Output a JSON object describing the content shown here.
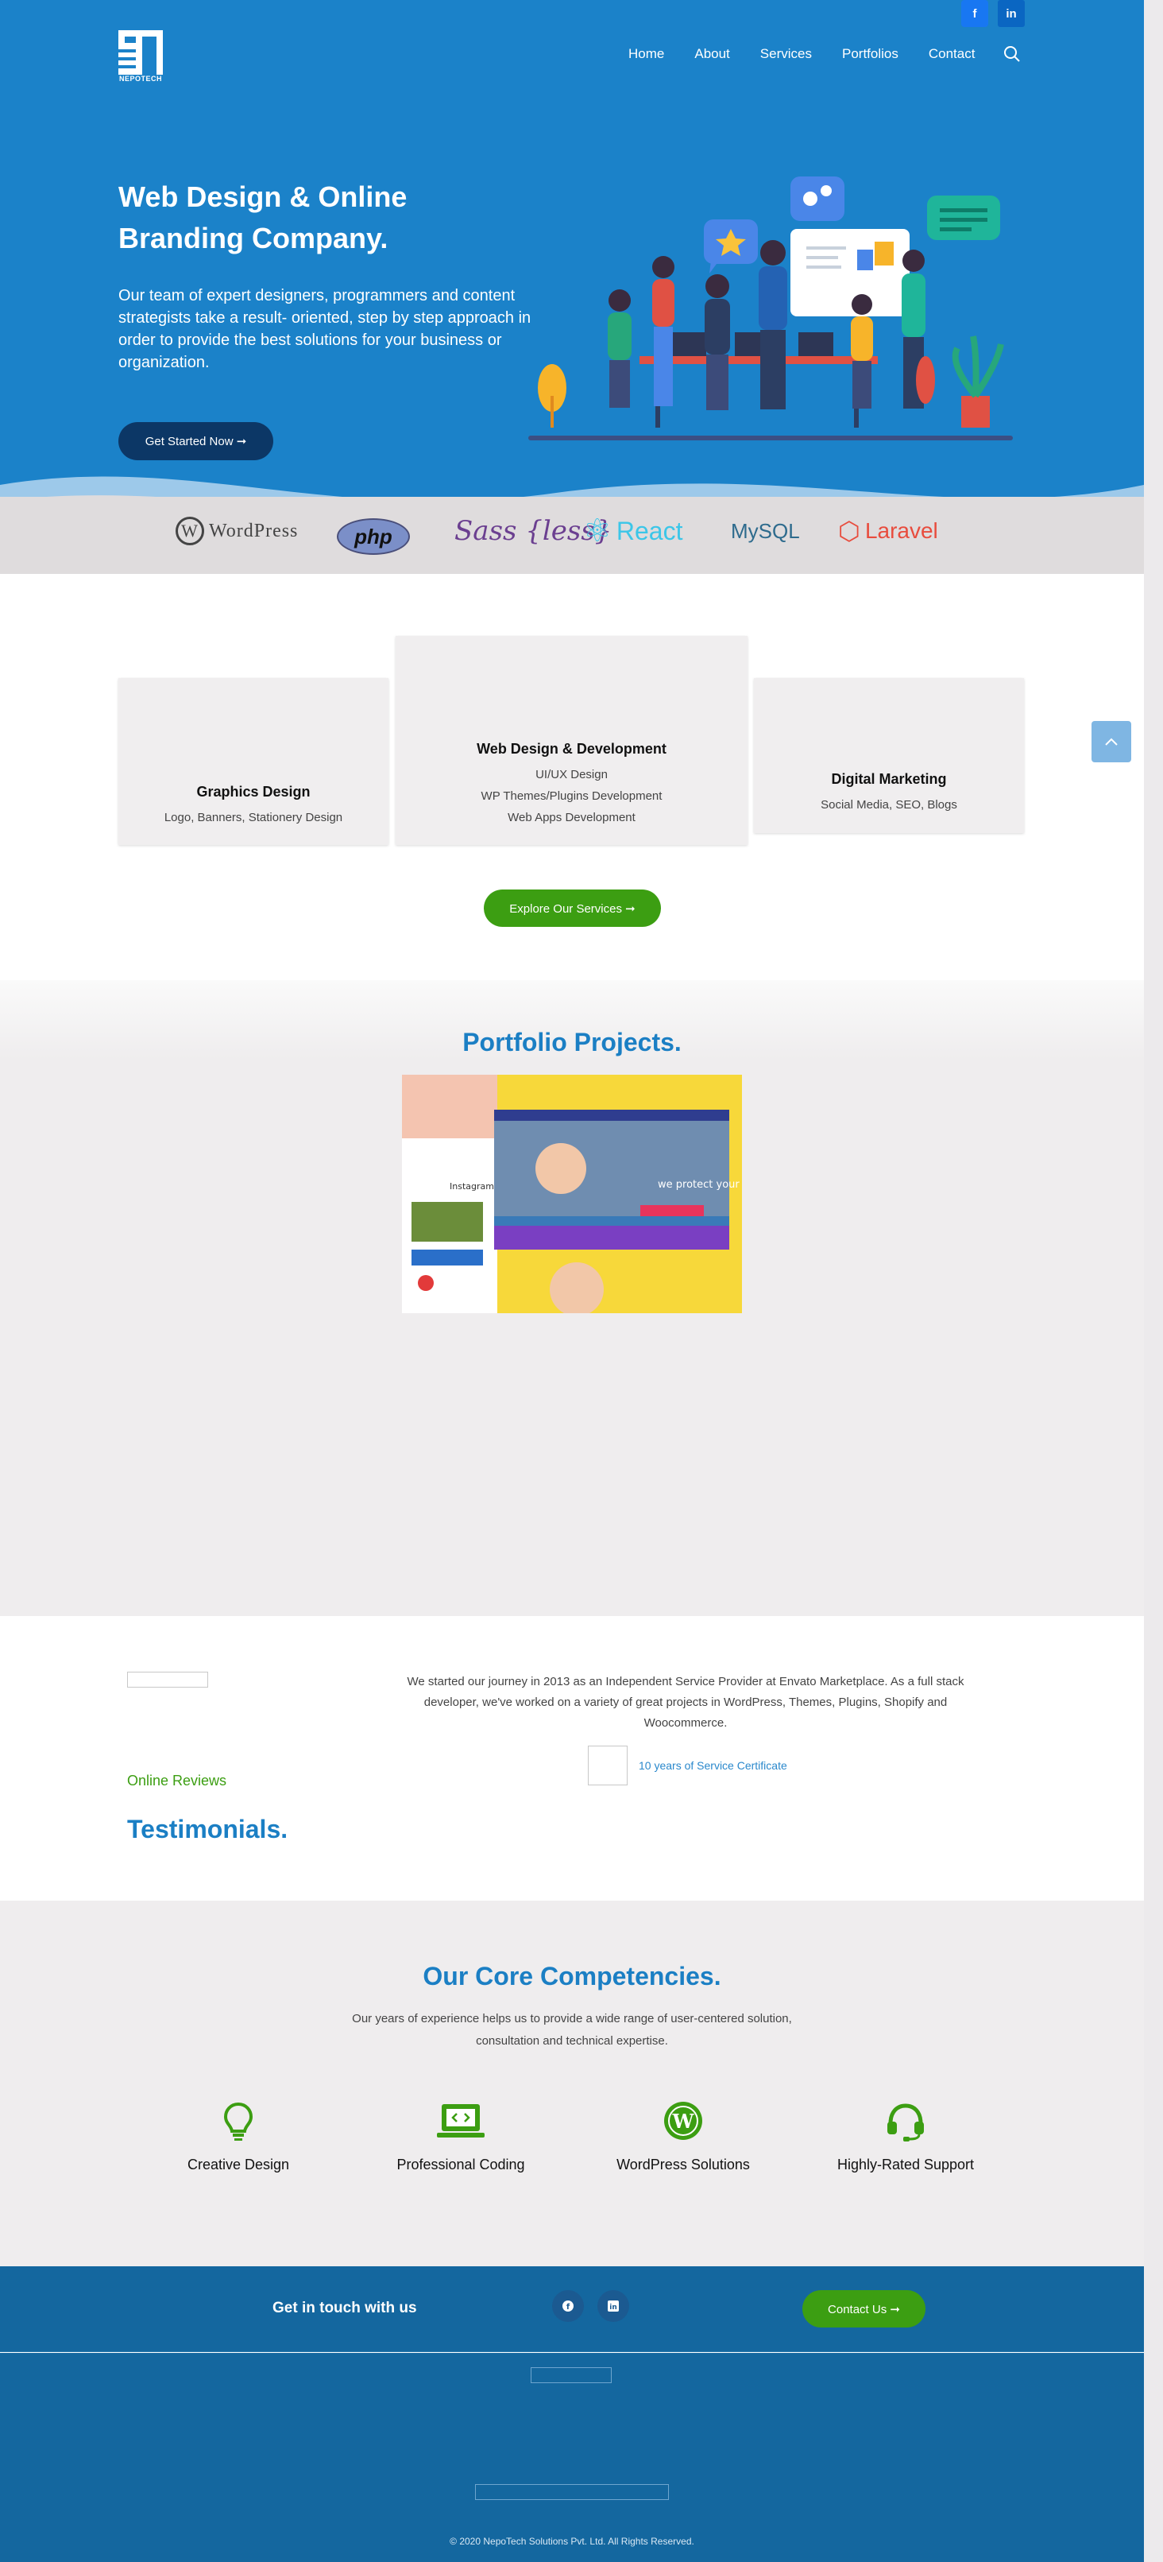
{
  "brand": {
    "logo_text": "NEPOTECH"
  },
  "nav": {
    "items": [
      "Home",
      "About",
      "Services",
      "Portfolios",
      "Contact"
    ]
  },
  "social": {
    "facebook": "f",
    "linkedin": "in"
  },
  "hero": {
    "title": "Web Design & Online Branding Company.",
    "lead": "Our team of expert designers, programmers and content strategists take a result- oriented, step by step approach in order to provide the best solutions for your business or organization.",
    "cta": "Get Started Now ➞"
  },
  "tech_logos": {
    "wordpress": "WordPress",
    "php": "php",
    "sass_less": "Sass {less}",
    "react": "React",
    "mysql": "MySQL",
    "laravel": "Laravel"
  },
  "services": {
    "cards": [
      {
        "title": "Graphics Design",
        "lines": [
          "Logo, Banners, Stationery Design"
        ]
      },
      {
        "title": "Web Design & Development",
        "lines": [
          "UI/UX Design",
          "WP Themes/Plugins Development",
          "Web Apps Development"
        ]
      },
      {
        "title": "Digital Marketing",
        "lines": [
          "Social Media, SEO, Blogs"
        ]
      }
    ],
    "cta": "Explore Our Services ➞"
  },
  "portfolio": {
    "heading": "Portfolio Projects.",
    "shot_caption": "we protect your baby",
    "shot_tag": "Instagram"
  },
  "testimonials": {
    "about": "We started our journey in 2013 as an Independent Service Provider at Envato Marketplace. As a full stack developer, we've worked on a variety of great projects in WordPress, Themes, Plugins, Shopify and Woocommerce.",
    "certificate": "10 years of Service Certificate",
    "eyebrow": "Online Reviews",
    "heading": "Testimonials."
  },
  "competencies": {
    "heading": "Our Core Competencies.",
    "intro": "Our years of experience helps us to provide a wide range of user-centered solution, consultation and technical expertise.",
    "items": [
      {
        "label": "Creative Design",
        "icon": "lightbulb-icon"
      },
      {
        "label": "Professional Coding",
        "icon": "code-laptop-icon"
      },
      {
        "label": "WordPress Solutions",
        "icon": "wordpress-icon"
      },
      {
        "label": "Highly-Rated Support",
        "icon": "headset-icon"
      }
    ]
  },
  "footer": {
    "get_in_touch": "Get in touch with us",
    "contact_cta": "Contact Us ➞",
    "copyright": "© 2020 NepoTech Solutions Pvt. Ltd. All Rights Reserved."
  },
  "colors": {
    "primary_blue": "#1b82c9",
    "heading_blue": "#1b7fc4",
    "green": "#3c9e12",
    "footer_blue": "#14679f",
    "navy": "#0c3766"
  }
}
